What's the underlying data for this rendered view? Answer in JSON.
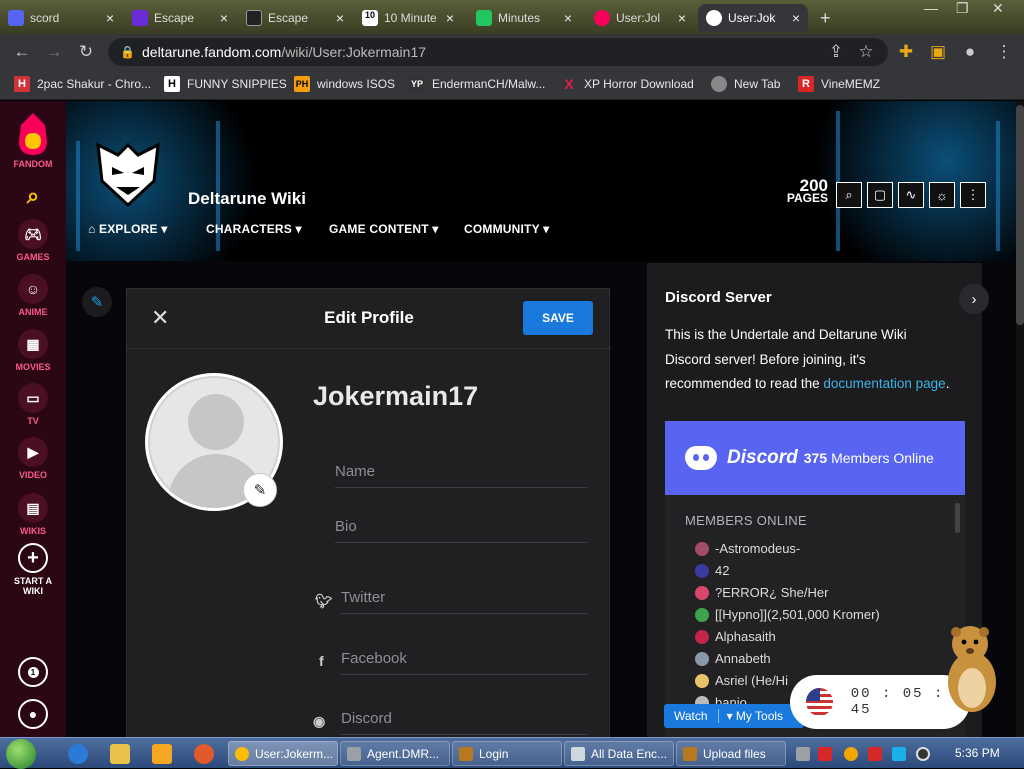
{
  "browser": {
    "tabs": [
      {
        "label": "scord",
        "color": "#5865f2"
      },
      {
        "label": "Escape",
        "color": "#6c2bd9"
      },
      {
        "label": "Escape",
        "color": "#222222"
      },
      {
        "label": "10 Minute",
        "color": "#444444"
      },
      {
        "label": "Minutes",
        "color": "#22c55e"
      },
      {
        "label": "User:Jol",
        "color": "#fa005a"
      },
      {
        "label": "User:Jok",
        "color": "#35363a"
      }
    ],
    "new_tab": "+",
    "url_host": "deltarune.fandom.com",
    "url_path": "/wiki/User:Jokermain17",
    "bookmarks": [
      {
        "label": "2pac Shakur - Chro...",
        "icon": "H",
        "color": "#d13438"
      },
      {
        "label": "FUNNY SNIPPIES",
        "icon": "H",
        "color": "#ffffff"
      },
      {
        "label": "windows ISOS",
        "icon": "PH",
        "color": "#f59e0b"
      },
      {
        "label": "EndermanCH/Malw...",
        "icon": "YP",
        "color": "#333333"
      },
      {
        "label": "XP Horror Download",
        "icon": "X",
        "color": "#e11d48"
      },
      {
        "label": "New Tab",
        "icon": "N",
        "color": "#888888"
      },
      {
        "label": "VineMEMZ",
        "icon": "R",
        "color": "#dc2626"
      }
    ]
  },
  "rail": {
    "brand": "FANDOM",
    "items": [
      {
        "label": "GAMES",
        "icon": "gamepad"
      },
      {
        "label": "ANIME",
        "icon": "anime"
      },
      {
        "label": "MOVIES",
        "icon": "film"
      },
      {
        "label": "TV",
        "icon": "tv"
      },
      {
        "label": "VIDEO",
        "icon": "play"
      },
      {
        "label": "WIKIS",
        "icon": "book"
      }
    ],
    "start_line1": "START A",
    "start_line2": "WIKI",
    "notif_count": "1"
  },
  "wiki": {
    "name": "Deltarune Wiki",
    "nav": [
      "EXPLORE",
      "CHARACTERS",
      "GAME CONTENT",
      "COMMUNITY"
    ],
    "pages_count": "200",
    "pages_label": "PAGES"
  },
  "modal": {
    "title": "Edit Profile",
    "save": "SAVE",
    "username": "Jokermain17",
    "fields": {
      "name": "Name",
      "bio": "Bio",
      "twitter": "Twitter",
      "facebook": "Facebook",
      "discord": "Discord"
    }
  },
  "discord_panel": {
    "title": "Discord Server",
    "text_before": "This is the Undertale and Deltarune Wiki Discord server! Before joining, it's recommended to read the ",
    "link": "documentation page",
    "text_after": ".",
    "brand": "Discord",
    "online_count": "375",
    "online_label": "Members Online",
    "members_header": "MEMBERS ONLINE",
    "members": [
      {
        "name": "-Astromodeus-",
        "color": "#a14a6a"
      },
      {
        "name": "42",
        "color": "#3a3aa0"
      },
      {
        "name": "?ERROR¿ She/Her",
        "color": "#d9486a"
      },
      {
        "name": "[[Hypno]](2,501,000 Kromer)",
        "color": "#3fa34d"
      },
      {
        "name": "Alphasaith",
        "color": "#c0264a"
      },
      {
        "name": "Annabeth",
        "color": "#8899aa"
      },
      {
        "name": "Asriel (He/Hi",
        "color": "#e7c36a"
      },
      {
        "name": "banjo",
        "color": "#bbbbbb"
      }
    ]
  },
  "toolbar": {
    "watch": "Watch",
    "my_tools": "My Tools"
  },
  "timer": {
    "h": "00",
    "m": "05",
    "s": "45"
  },
  "taskbar": {
    "tasks": [
      {
        "label": "User:Jokerm...",
        "color": "#fbbc04"
      },
      {
        "label": "Agent.DMR...",
        "color": "#9aa0a6"
      },
      {
        "label": "Login",
        "color": "#b7791f"
      },
      {
        "label": "All Data Enc...",
        "color": "#cfd8dc"
      },
      {
        "label": "Upload files",
        "color": "#b7791f"
      }
    ],
    "clock": "5:36 PM"
  }
}
